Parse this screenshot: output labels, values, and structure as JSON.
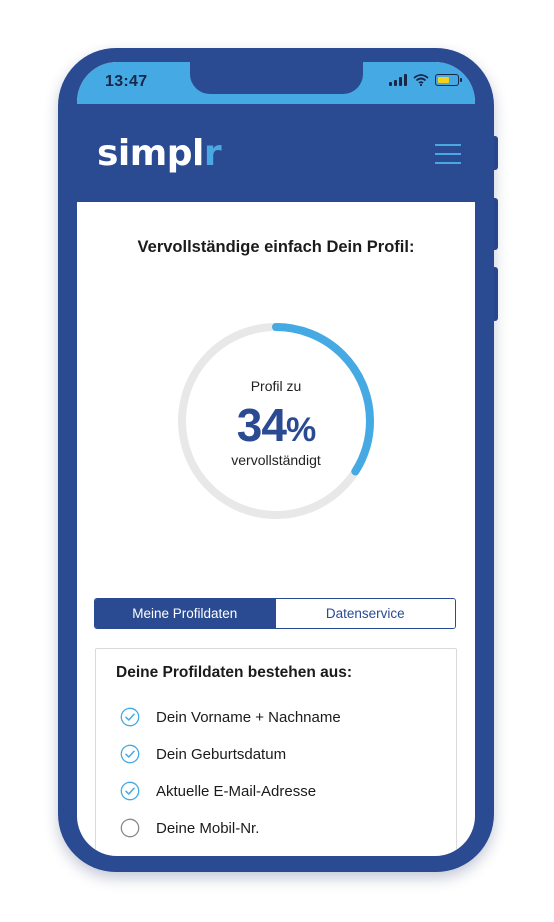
{
  "status_bar": {
    "time": "13:47",
    "icons": [
      "signal-icon",
      "wifi-icon",
      "battery-icon"
    ]
  },
  "header": {
    "logo_main": "simpl",
    "logo_accent": "r",
    "menu_icon": "hamburger-menu-icon"
  },
  "profile": {
    "title": "Vervollständige einfach Dein Profil:",
    "progress_label_top": "Profil zu",
    "progress_value": "34",
    "progress_unit": "%",
    "progress_label_bottom": "vervollständigt",
    "progress_fraction": 0.34
  },
  "tabs": [
    {
      "label": "Meine Profildaten",
      "active": true
    },
    {
      "label": "Datenservice",
      "active": false
    }
  ],
  "card": {
    "title": "Deine Profildaten bestehen aus:",
    "items": [
      {
        "label": "Dein Vorname + Nachname",
        "checked": true
      },
      {
        "label": "Dein Geburtsdatum",
        "checked": true
      },
      {
        "label": "Aktuelle E-Mail-Adresse",
        "checked": true
      },
      {
        "label": "Deine Mobil-Nr.",
        "checked": false
      }
    ]
  },
  "colors": {
    "brand_dark": "#2a4a92",
    "brand_light": "#45a9e3",
    "ring_track": "#e8e8e8",
    "battery": "#f2d21b"
  }
}
